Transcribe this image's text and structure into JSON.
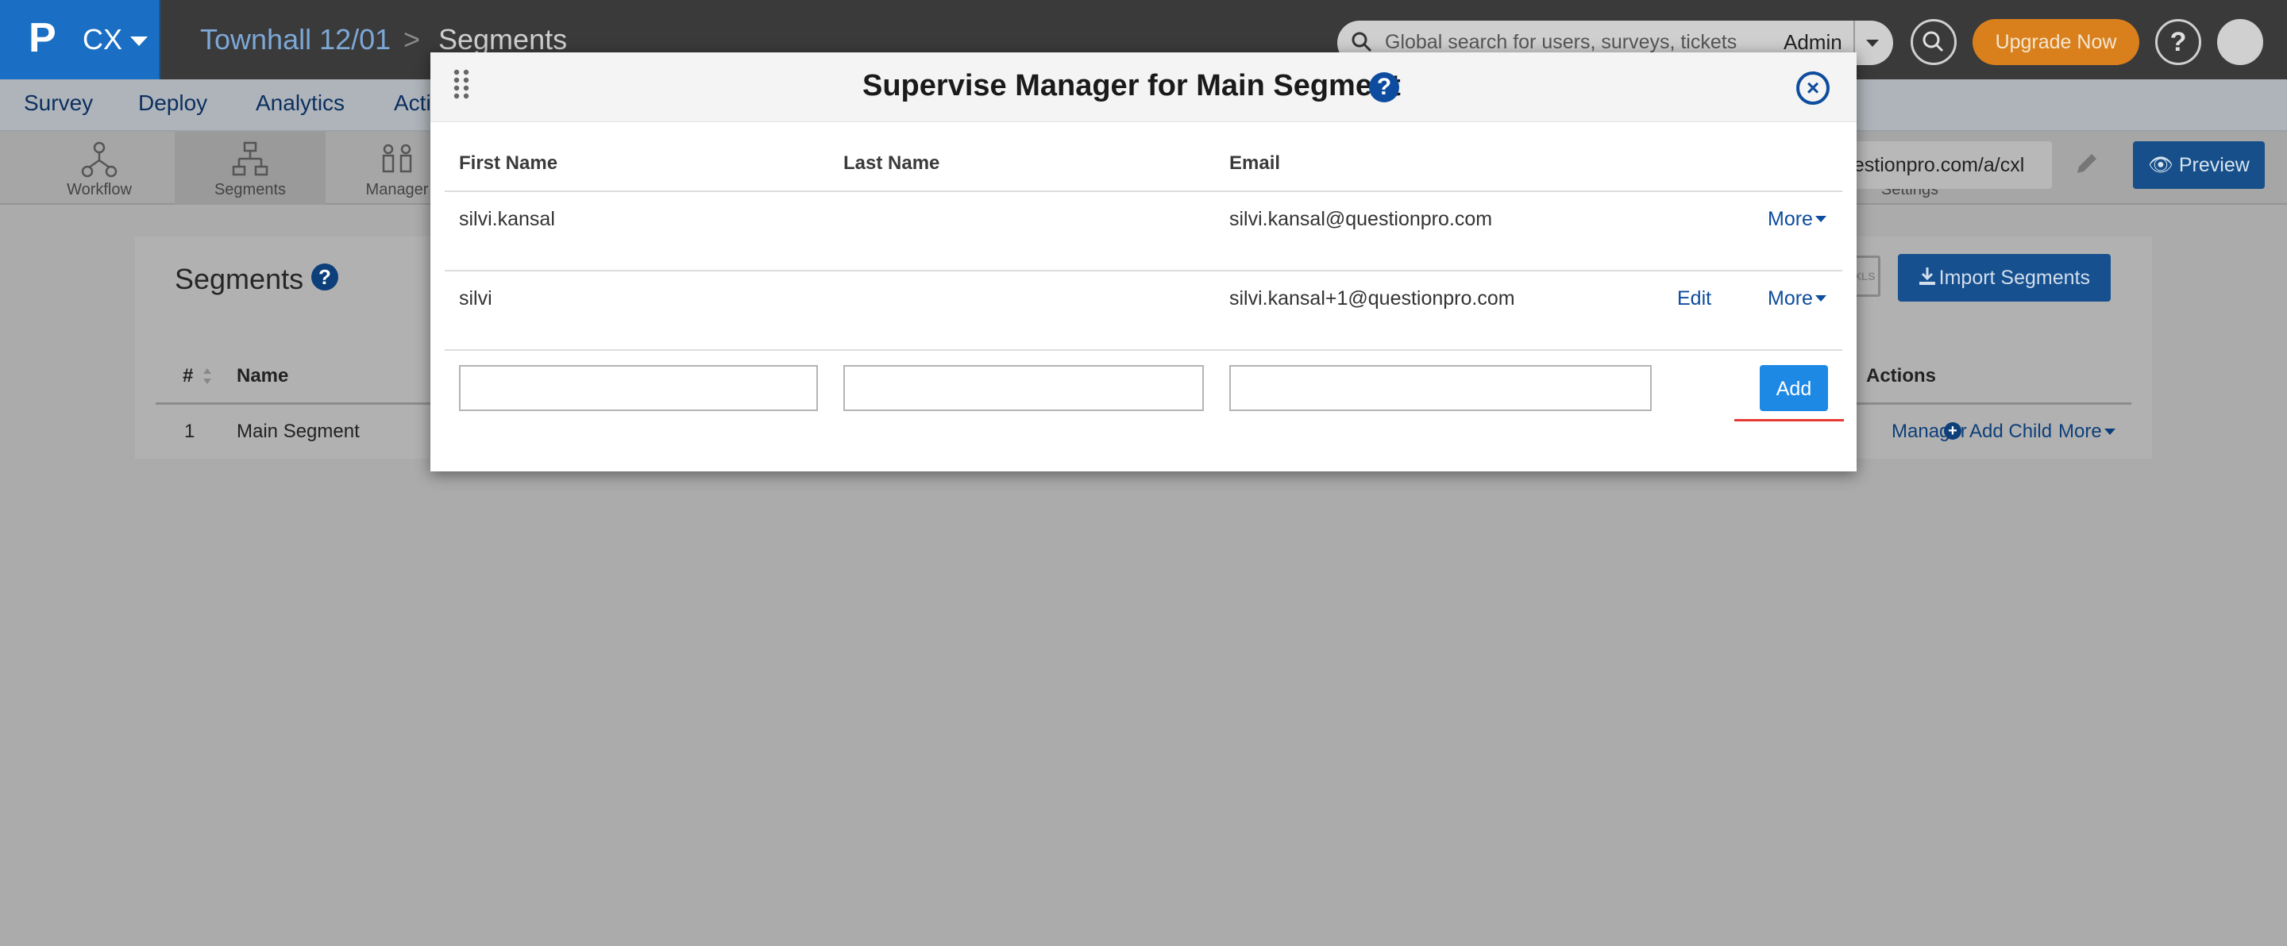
{
  "app": {
    "brand_initial": "P",
    "product": "CX"
  },
  "breadcrumb": {
    "project": "Townhall 12/01",
    "separator": ">",
    "current": "Segments"
  },
  "header": {
    "search_placeholder": "Global search for users, surveys, tickets",
    "user_menu_label": "Admin",
    "upgrade_label": "Upgrade Now",
    "help_label": "?"
  },
  "nav": {
    "items": [
      "Survey",
      "Deploy",
      "Analytics",
      "Acti"
    ]
  },
  "toolbar": {
    "tools": [
      {
        "label": "Workflow",
        "icon": "workflow-icon"
      },
      {
        "label": "Segments",
        "icon": "segments-icon"
      },
      {
        "label": "Manager",
        "icon": "managers-icon"
      },
      {
        "label": "Settings",
        "icon": "gear-icon"
      }
    ],
    "url_text": "uestionpro.com/a/cxl",
    "preview_label": "Preview"
  },
  "segments_page": {
    "title": "Segments",
    "import_label": "Import Segments",
    "xls_label": "XLS",
    "columns": {
      "num": "#",
      "name": "Name",
      "actions": "Actions"
    },
    "rows": [
      {
        "num": "1",
        "name": "Main Segment",
        "manager": "Manager",
        "add_child": "Add Child",
        "more": "More"
      }
    ]
  },
  "modal": {
    "title": "Supervise Manager for Main Segment",
    "help_label": "?",
    "close_label": "×",
    "columns": {
      "first_name": "First Name",
      "last_name": "Last Name",
      "email": "Email"
    },
    "rows": [
      {
        "first_name": "silvi.kansal",
        "last_name": "",
        "email": "silvi.kansal@questionpro.com",
        "edit": "",
        "more": "More"
      },
      {
        "first_name": "silvi",
        "last_name": "",
        "email": "silvi.kansal+1@questionpro.com",
        "edit": "Edit",
        "more": "More"
      }
    ],
    "new_row": {
      "first_name_value": "",
      "last_name_value": "",
      "email_value": ""
    },
    "add_label": "Add"
  },
  "colors": {
    "brand_blue": "#1a6fc4",
    "link_blue": "#0d4c9e",
    "add_button": "#1e88e5",
    "upgrade_orange": "#d9801d",
    "highlight_red": "#e53935",
    "overlay_gray": "#ababab"
  }
}
